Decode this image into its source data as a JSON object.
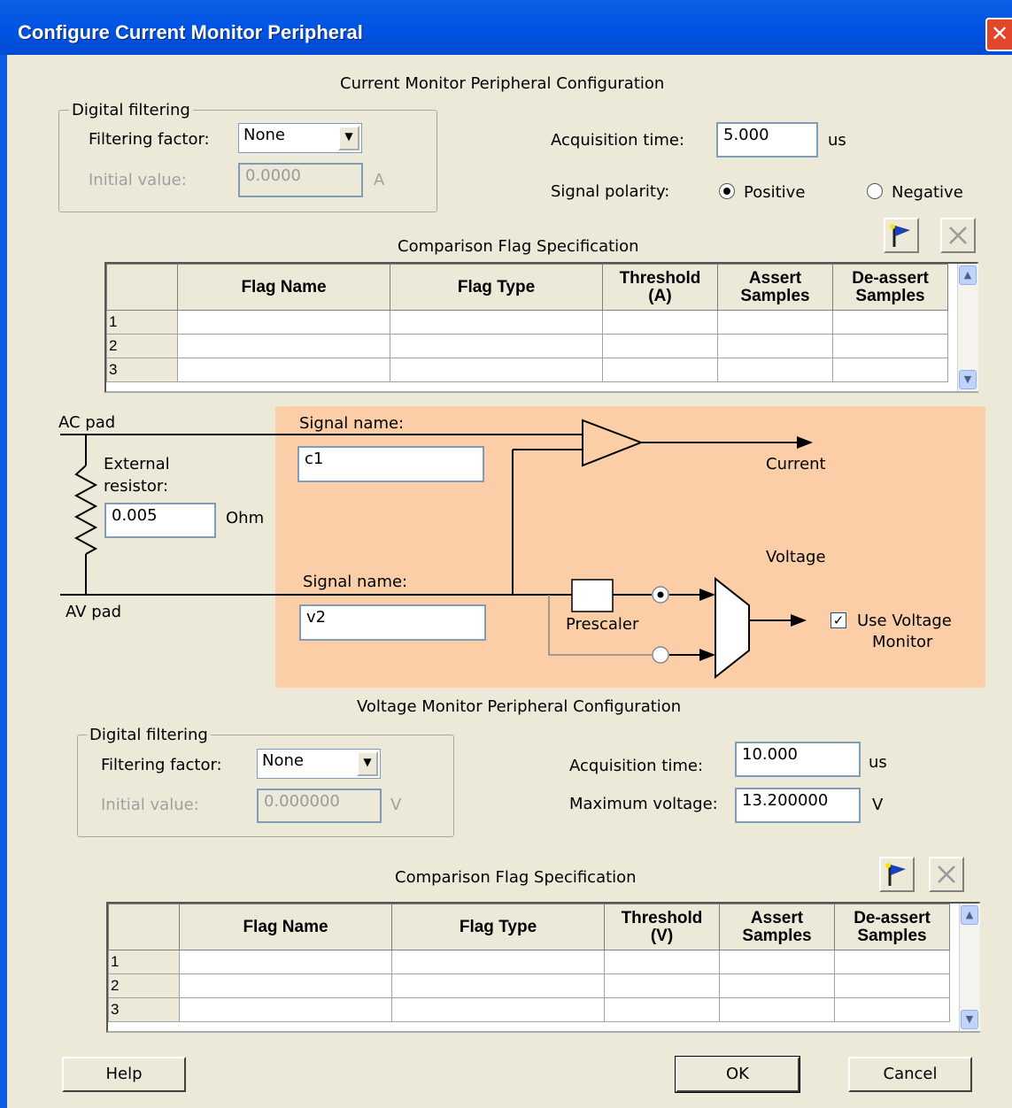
{
  "window": {
    "title": "Configure Current Monitor Peripheral",
    "close_glyph": "✕"
  },
  "current_section": {
    "heading": "Current Monitor Peripheral Configuration",
    "digital_filtering": {
      "group_label": "Digital filtering",
      "filtering_factor_label": "Filtering factor:",
      "filtering_factor_value": "None",
      "initial_value_label": "Initial value:",
      "initial_value": "0.0000",
      "initial_value_unit": "A"
    },
    "acquisition_time_label": "Acquisition  time:",
    "acquisition_time_value": "5.000",
    "acquisition_time_unit": "us",
    "signal_polarity_label": "Signal polarity:",
    "polarity_options": [
      "Positive",
      "Negative"
    ],
    "polarity_selected": "Positive"
  },
  "current_flags": {
    "heading": "Comparison Flag Specification",
    "columns": [
      "Flag Name",
      "Flag Type",
      "Threshold (A)",
      "Assert Samples",
      "De-assert Samples"
    ],
    "column_lines": [
      [
        "Flag Name"
      ],
      [
        "Flag Type"
      ],
      [
        "Threshold",
        "(A)"
      ],
      [
        "Assert",
        "Samples"
      ],
      [
        "De-assert",
        "Samples"
      ]
    ],
    "rows": [
      "1",
      "2",
      "3"
    ]
  },
  "diagram": {
    "ac_pad_label": "AC pad",
    "av_pad_label": "AV pad",
    "external_resistor_label_line1": "External",
    "external_resistor_label_line2": "resistor:",
    "external_resistor_value": "0.005",
    "external_resistor_unit": "Ohm",
    "current_signal_name_label": "Signal name:",
    "current_signal_name_value": "c1",
    "voltage_signal_name_label": "Signal name:",
    "voltage_signal_name_value": "v2",
    "current_output_label": "Current",
    "voltage_label": "Voltage",
    "prescaler_label": "Prescaler",
    "use_voltage_monitor_line1": "Use Voltage",
    "use_voltage_monitor_line2": "Monitor",
    "use_voltage_monitor_checked": true
  },
  "voltage_section": {
    "heading": "Voltage Monitor Peripheral Configuration",
    "digital_filtering": {
      "group_label": "Digital filtering",
      "filtering_factor_label": "Filtering factor:",
      "filtering_factor_value": "None",
      "initial_value_label": "Initial value:",
      "initial_value": "0.000000",
      "initial_value_unit": "V"
    },
    "acquisition_time_label": "Acquisition  time:",
    "acquisition_time_value": "10.000",
    "acquisition_time_unit": "us",
    "max_voltage_label": "Maximum voltage:",
    "max_voltage_value": "13.200000",
    "max_voltage_unit": "V"
  },
  "voltage_flags": {
    "heading": "Comparison Flag Specification",
    "columns": [
      "Flag Name",
      "Flag Type",
      "Threshold (V)",
      "Assert Samples",
      "De-assert Samples"
    ],
    "column_lines": [
      [
        "Flag Name"
      ],
      [
        "Flag Type"
      ],
      [
        "Threshold",
        "(V)"
      ],
      [
        "Assert",
        "Samples"
      ],
      [
        "De-assert",
        "Samples"
      ]
    ],
    "rows": [
      "1",
      "2",
      "3"
    ]
  },
  "buttons": {
    "help": "Help",
    "ok": "OK",
    "cancel": "Cancel"
  },
  "colors": {
    "title_bar": "#0054e3",
    "diagram_bg": "#fbcea7",
    "dialog_bg": "#ece9d8",
    "close_button": "#e2462b"
  }
}
